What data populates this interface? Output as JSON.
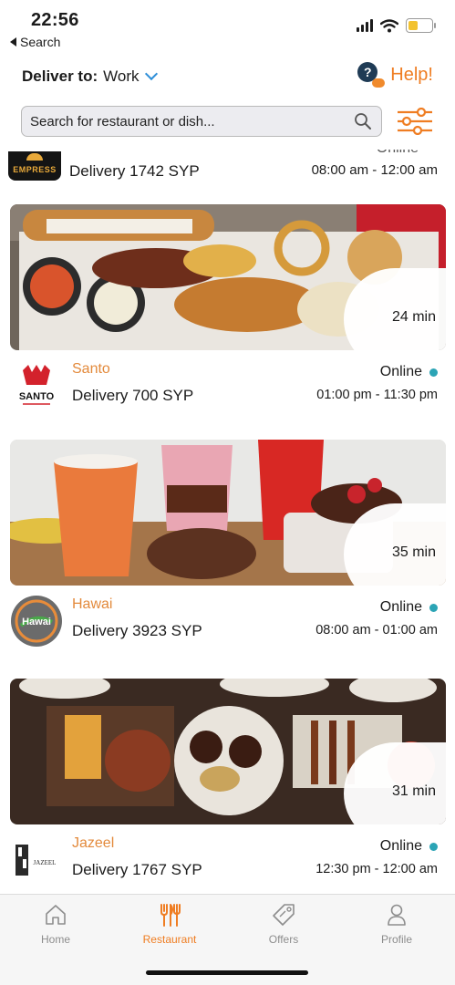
{
  "status_bar": {
    "time": "22:56",
    "back_label": "Search"
  },
  "header": {
    "deliver_label": "Deliver to:",
    "deliver_value": "Work",
    "help_label": "Help!"
  },
  "search": {
    "placeholder": "Search for restaurant or dish..."
  },
  "partial_restaurant": {
    "logo_text": "EMPRESS",
    "status": "Online",
    "delivery": "Delivery 1742 SYP",
    "hours": "08:00 am - 12:00 am"
  },
  "restaurants": [
    {
      "name": "Santo",
      "logo_text": "SANTO",
      "status": "Online",
      "delivery": "Delivery 700 SYP",
      "hours": "01:00 pm - 11:30 pm",
      "eta": "24 min"
    },
    {
      "name": "Hawai",
      "logo_text": "Hawai",
      "status": "Online",
      "delivery": "Delivery 3923 SYP",
      "hours": "08:00 am - 01:00 am",
      "eta": "35 min"
    },
    {
      "name": "Jazeel",
      "logo_text": "JAZEEL",
      "status": "Online",
      "delivery": "Delivery 1767 SYP",
      "hours": "12:30 pm - 12:00 am",
      "eta": "31 min"
    }
  ],
  "tabs": [
    {
      "label": "Home",
      "icon": "home-icon"
    },
    {
      "label": "Restaurant",
      "icon": "cutlery-icon",
      "active": true
    },
    {
      "label": "Offers",
      "icon": "tag-icon"
    },
    {
      "label": "Profile",
      "icon": "person-icon"
    }
  ],
  "colors": {
    "accent": "#ef7d22",
    "online_dot": "#2ba4b5",
    "chevron": "#2e8fd8"
  }
}
